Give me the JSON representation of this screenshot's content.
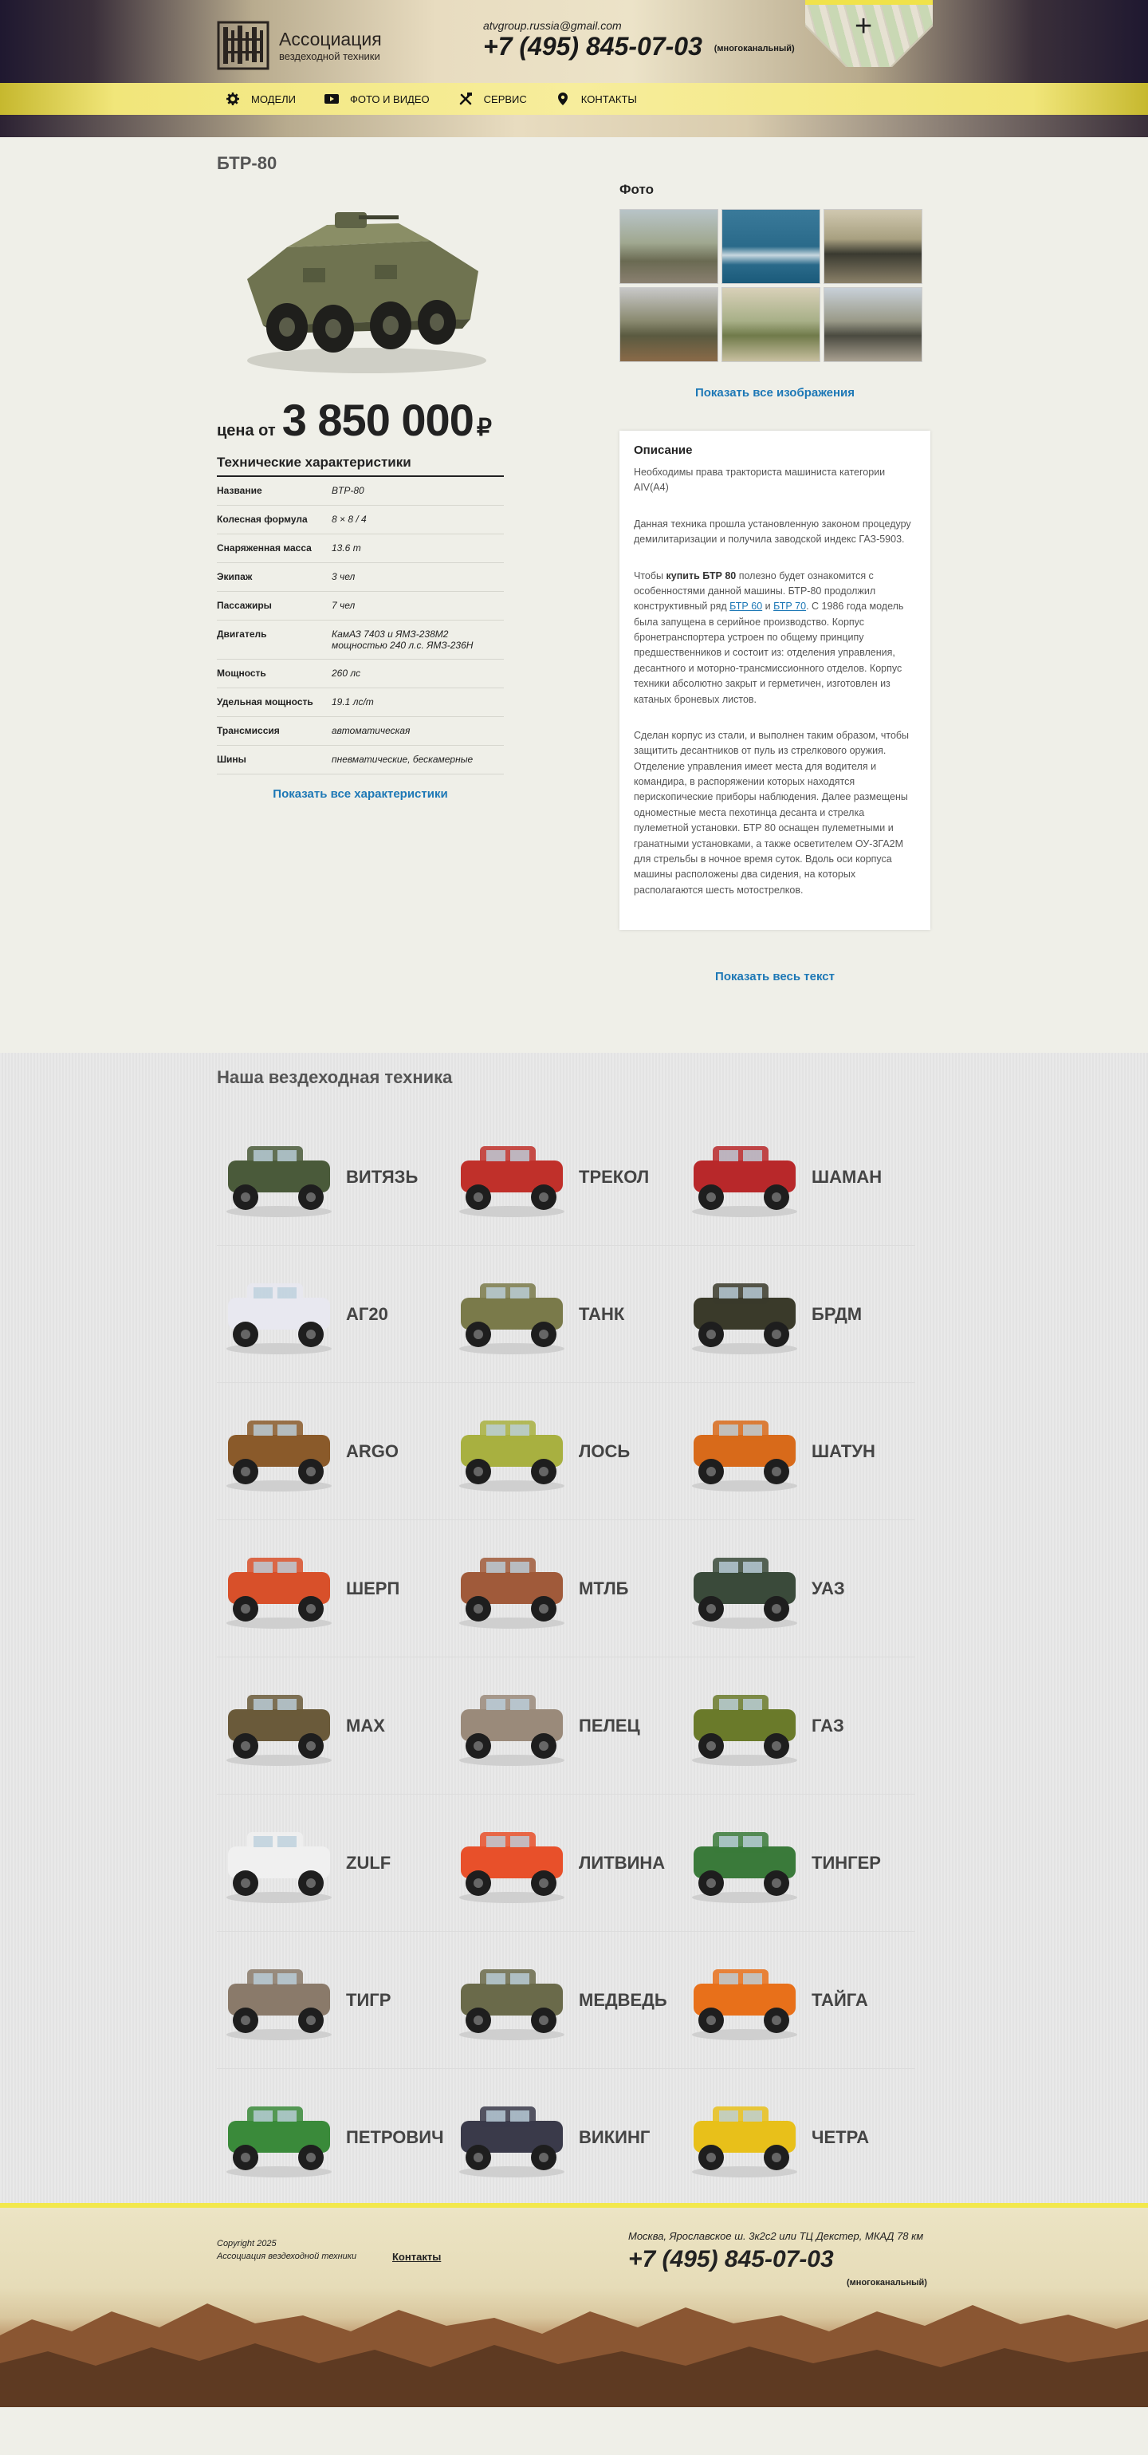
{
  "header": {
    "logo_title": "Ассоциация",
    "logo_subtitle": "вездеходной техники",
    "email": "atvgroup.russia@gmail.com",
    "phone": "+7 (495) 845-07-03",
    "phone_note": "(многоканальный)",
    "map_plus": "+"
  },
  "nav": {
    "items": [
      {
        "label": "МОДЕЛИ",
        "icon": "gear-icon"
      },
      {
        "label": "ФОТО И ВИДЕО",
        "icon": "video-icon"
      },
      {
        "label": "СЕРВИС",
        "icon": "tools-icon"
      },
      {
        "label": "КОНТАКТЫ",
        "icon": "map-pin-icon"
      }
    ]
  },
  "product": {
    "title": "БТР-80",
    "price_label": "цена от",
    "price_value": "3 850 000",
    "price_currency": "₽",
    "specs_title": "Технические характеристики",
    "specs": [
      {
        "key": "Название",
        "value": "BTP-80"
      },
      {
        "key": "Колесная формула",
        "value": "8 × 8 / 4"
      },
      {
        "key": "Снаряженная масса",
        "value": "13.6 т"
      },
      {
        "key": "Экипаж",
        "value": "3 чел"
      },
      {
        "key": "Пассажиры",
        "value": "7 чел"
      },
      {
        "key": "Двигатель",
        "value": "КамАЗ 7403 и ЯМЗ-238М2 мощностью 240 л.с. ЯМЗ-236Н"
      },
      {
        "key": "Мощность",
        "value": "260 лс"
      },
      {
        "key": "Удельная мощность",
        "value": "19.1 лс/т"
      },
      {
        "key": "Трансмиссия",
        "value": "автоматическая"
      },
      {
        "key": "Шины",
        "value": "пневматические, бескамерные"
      }
    ],
    "specs_more": "Показать все характеристики",
    "photos_title": "Фото",
    "photos_more": "Показать все изображения",
    "desc_title": "Описание",
    "desc_p1": "Необходимы права тракториста машиниста категории AIV(A4)",
    "desc_p2": "Данная техника прошла установленную законом процедуру демилитаризации и получила заводской индекс ГАЗ-5903.",
    "desc_p3_a": "Чтобы ",
    "desc_p3_b": "купить БТР 80",
    "desc_p3_c": " полезно будет ознакомится с особенностями данной машины. БТР-80 продолжил конструктивный ряд ",
    "desc_p3_link1": "БТР 60",
    "desc_p3_d": " и ",
    "desc_p3_link2": "БТР 70",
    "desc_p3_e": ". С 1986 года модель была запущена в серийное производство. Корпус бронетранспортера устроен по общему принципу предшественников и состоит из: отделения управления, десантного и моторно-трансмиссионного отделов. Корпус техники абсолютно закрыт и герметичен, изготовлен из катаных броневых листов.",
    "desc_p4": "Сделан корпус из стали, и выполнен таким образом, чтобы защитить десантников от пуль из стрелкового оружия. Отделение управления имеет места для водителя и командира, в распоряжении которых находятся перископические приборы наблюдения. Далее размещены одноместные места пехотинца десанта и стрелка пулеметной установки. БТР 80 оснащен пулеметными и гранатными установками, а также осветителем ОУ-3ГА2М для стрельбы в ночное время суток. Вдоль оси корпуса машины расположены два сидения, на которых располагаются шесть мотострелков.",
    "desc_more": "Показать весь текст"
  },
  "catalog": {
    "title": "Наша вездеходная техника",
    "items": [
      {
        "name": "ВИТЯЗЬ",
        "color": "#4a5a3a"
      },
      {
        "name": "ТРЕКОЛ",
        "color": "#c0302a"
      },
      {
        "name": "ШАМАН",
        "color": "#b8282a"
      },
      {
        "name": "АГ20",
        "color": "#e8e8f0"
      },
      {
        "name": "ТАНК",
        "color": "#7a7a4a"
      },
      {
        "name": "БРДМ",
        "color": "#3a3a2a"
      },
      {
        "name": "ARGO",
        "color": "#8a5a2a"
      },
      {
        "name": "ЛОСЬ",
        "color": "#a8b040"
      },
      {
        "name": "ШАТУН",
        "color": "#d86a1a"
      },
      {
        "name": "ШЕРП",
        "color": "#d8502a"
      },
      {
        "name": "МТЛБ",
        "color": "#a05a3a"
      },
      {
        "name": "УАЗ",
        "color": "#3a4a3a"
      },
      {
        "name": "MAX",
        "color": "#6a5a3a"
      },
      {
        "name": "ПЕЛЕЦ",
        "color": "#9a8a7a"
      },
      {
        "name": "ГАЗ",
        "color": "#6a7a2a"
      },
      {
        "name": "ZULF",
        "color": "#f0f0f0"
      },
      {
        "name": "ЛИТВИНА",
        "color": "#e8502a"
      },
      {
        "name": "ТИНГЕР",
        "color": "#3a7a3a"
      },
      {
        "name": "ТИГР",
        "color": "#8a7a6a"
      },
      {
        "name": "МЕДВЕДЬ",
        "color": "#6a6a4a"
      },
      {
        "name": "ТАЙГА",
        "color": "#e8701a"
      },
      {
        "name": "ПЕТРОВИЧ",
        "color": "#3a8a3a"
      },
      {
        "name": "ВИКИНГ",
        "color": "#3a3a4a"
      },
      {
        "name": "ЧЕТРА",
        "color": "#e8c01a"
      }
    ]
  },
  "footer": {
    "copyright": "Copyright 2025",
    "org": "Ассоциация вездеходной техники",
    "contacts_link": "Контакты",
    "address": "Москва, Ярославское ш. 3к2с2 или ТЦ Декстер, МКАД 78 км",
    "phone": "+7 (495) 845-07-03",
    "phone_note": "(многоканальный)"
  },
  "colors": {
    "accent_yellow": "#f2e84c",
    "link_blue": "#1d78b6"
  }
}
